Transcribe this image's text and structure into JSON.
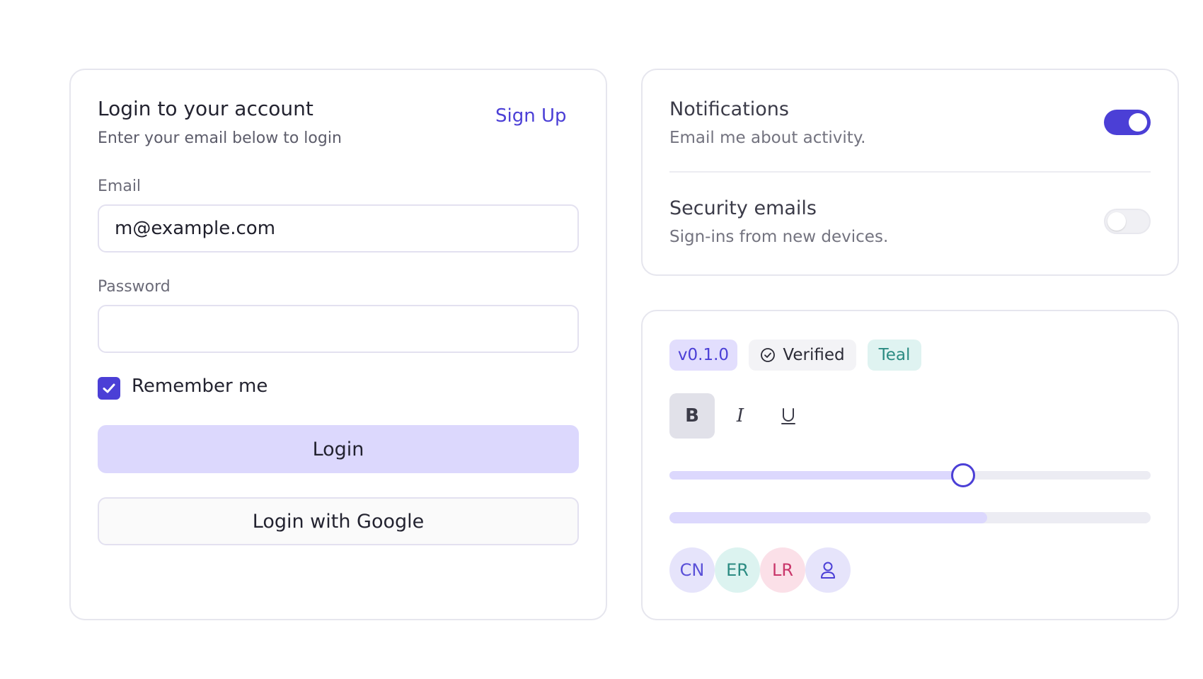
{
  "login": {
    "title": "Login to your account",
    "subtitle": "Enter your email below to login",
    "signup_label": "Sign Up",
    "email_label": "Email",
    "email_value": "m@example.com",
    "password_label": "Password",
    "password_value": "",
    "remember_label": "Remember me",
    "remember_checked": true,
    "login_label": "Login",
    "google_label": "Login with Google"
  },
  "settings": {
    "items": [
      {
        "title": "Notifications",
        "description": "Email me about activity.",
        "enabled": true
      },
      {
        "title": "Security emails",
        "description": "Sign-ins from new devices.",
        "enabled": false
      }
    ]
  },
  "components": {
    "badges": [
      {
        "label": "v0.1.0"
      },
      {
        "label": "Verified",
        "icon": "check-circle-icon"
      },
      {
        "label": "Teal"
      }
    ],
    "formatting": [
      {
        "label": "B",
        "icon": "bold-icon",
        "active": true
      },
      {
        "label": "I",
        "icon": "italic-icon",
        "active": false
      },
      {
        "label": "U",
        "icon": "underline-icon",
        "active": false
      }
    ],
    "slider_value": 0.61,
    "progress_value": 0.66,
    "avatars": [
      {
        "initials": "CN"
      },
      {
        "initials": "ER"
      },
      {
        "initials": "LR"
      },
      {
        "initials": "",
        "icon": "user-icon"
      }
    ]
  },
  "colors": {
    "accent": "#4b3fd6",
    "accent_soft": "#dcd8fd",
    "border": "#e6e6ee",
    "teal": "#2b8b82",
    "rose": "#c9366a"
  }
}
